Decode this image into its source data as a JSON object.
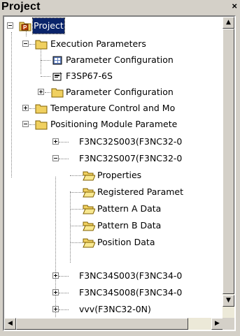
{
  "window": {
    "title": "Project",
    "close_label": "×"
  },
  "tree": {
    "root": "Project",
    "items": [
      "Execution Parameters",
      "Parameter Configuration",
      "F3SP67-6S",
      "Parameter Configuration",
      "Temperature Control and Mo",
      "Positioning Module Paramete",
      "F3NC32S003(F3NC32-0",
      "F3NC32S007(F3NC32-0",
      "Properties",
      "Registered Paramet",
      "Pattern A Data",
      "Pattern B Data",
      "Position Data",
      "F3NC34S003(F3NC34-0",
      "F3NC34S008(F3NC34-0",
      "vvv(F3NC32-0N)"
    ]
  },
  "icons": {
    "root": "project-icon",
    "folder": "folder-icon",
    "open_folder": "open-folder-icon",
    "config": "configuration-icon",
    "cpu": "cpu-module-icon"
  },
  "colors": {
    "selection": "#0a246a",
    "folder": "#f0d060"
  }
}
